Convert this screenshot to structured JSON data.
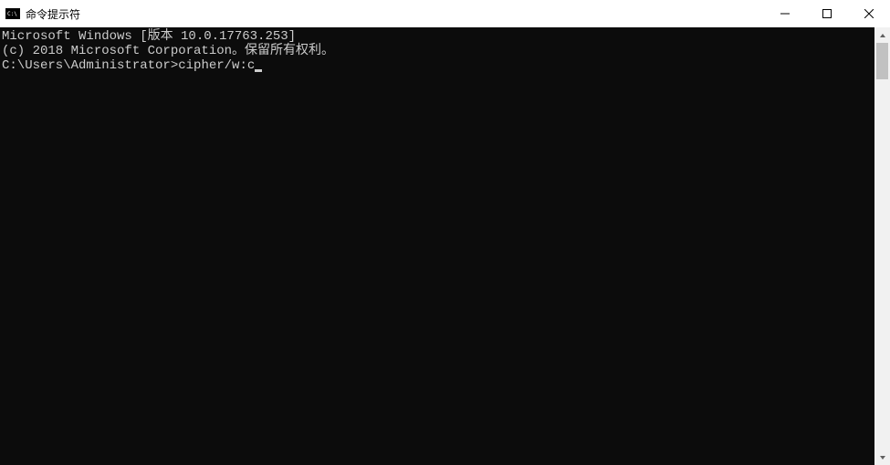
{
  "window": {
    "title": "命令提示符"
  },
  "console": {
    "line1": "Microsoft Windows [版本 10.0.17763.253]",
    "line2": "(c) 2018 Microsoft Corporation。保留所有权利。",
    "blank": "",
    "prompt": "C:\\Users\\Administrator>",
    "command": "cipher/w:c"
  }
}
